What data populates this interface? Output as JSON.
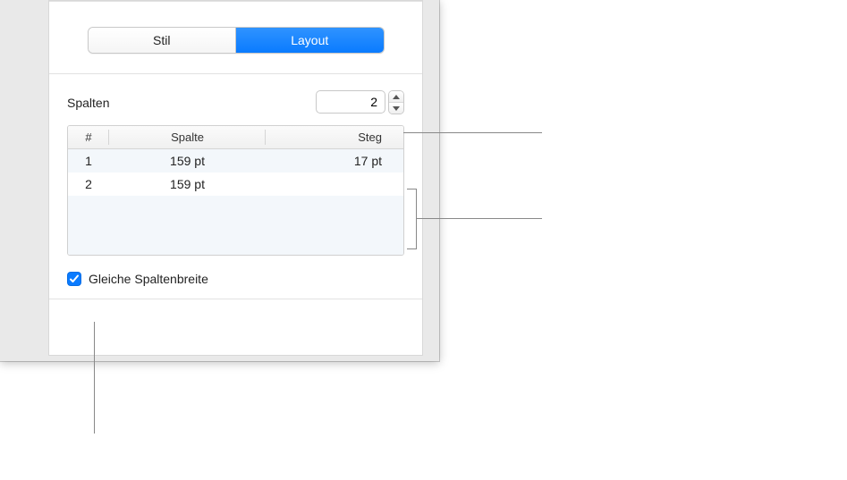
{
  "segmented": {
    "style_label": "Stil",
    "layout_label": "Layout"
  },
  "columns": {
    "label": "Spalten",
    "value": "2"
  },
  "table": {
    "headers": {
      "num": "#",
      "col": "Spalte",
      "gutter": "Steg"
    },
    "rows": [
      {
        "num": "1",
        "col": "159 pt",
        "gutter": "17 pt"
      },
      {
        "num": "2",
        "col": "159 pt",
        "gutter": ""
      }
    ]
  },
  "equal_width": {
    "label": "Gleiche Spaltenbreite",
    "checked": true
  }
}
